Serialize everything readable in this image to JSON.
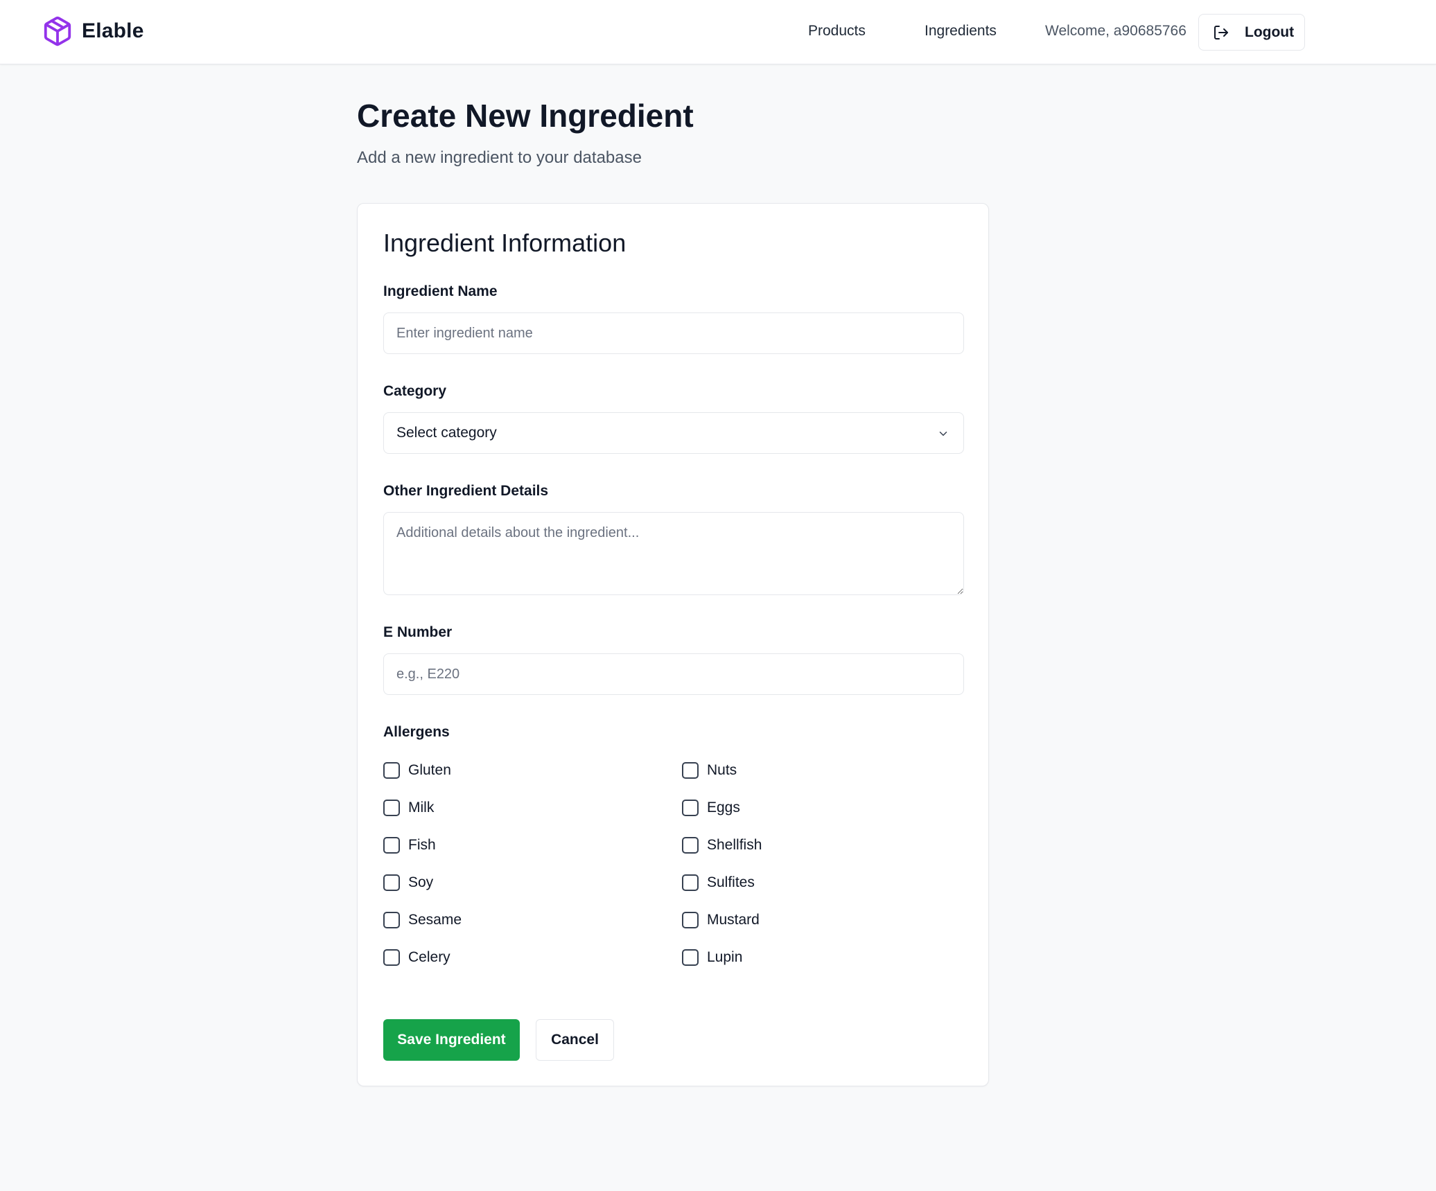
{
  "header": {
    "brand": "Elable",
    "brand_icon": "box-icon",
    "brand_color": "#9333ea",
    "nav": [
      "Products",
      "Ingredients"
    ],
    "welcome": "Welcome, a90685766",
    "logout_label": "Logout",
    "logout_icon": "logout-icon"
  },
  "page": {
    "title": "Create New Ingredient",
    "subtitle": "Add a new ingredient to your database"
  },
  "form": {
    "card_title": "Ingredient Information",
    "name_label": "Ingredient Name",
    "name_placeholder": "Enter ingredient name",
    "name_value": "",
    "category_label": "Category",
    "category_value": "Select category",
    "details_label": "Other Ingredient Details",
    "details_placeholder": "Additional details about the ingredient...",
    "details_value": "",
    "e_number_label": "E Number",
    "e_number_placeholder": "e.g., E220",
    "e_number_value": "",
    "allergens_label": "Allergens",
    "allergens": [
      {
        "label": "Gluten",
        "checked": false
      },
      {
        "label": "Nuts",
        "checked": false
      },
      {
        "label": "Milk",
        "checked": false
      },
      {
        "label": "Eggs",
        "checked": false
      },
      {
        "label": "Fish",
        "checked": false
      },
      {
        "label": "Shellfish",
        "checked": false
      },
      {
        "label": "Soy",
        "checked": false
      },
      {
        "label": "Sulfites",
        "checked": false
      },
      {
        "label": "Sesame",
        "checked": false
      },
      {
        "label": "Mustard",
        "checked": false
      },
      {
        "label": "Celery",
        "checked": false
      },
      {
        "label": "Lupin",
        "checked": false
      }
    ],
    "save_label": "Save Ingredient",
    "cancel_label": "Cancel",
    "save_color": "#16a34a"
  }
}
